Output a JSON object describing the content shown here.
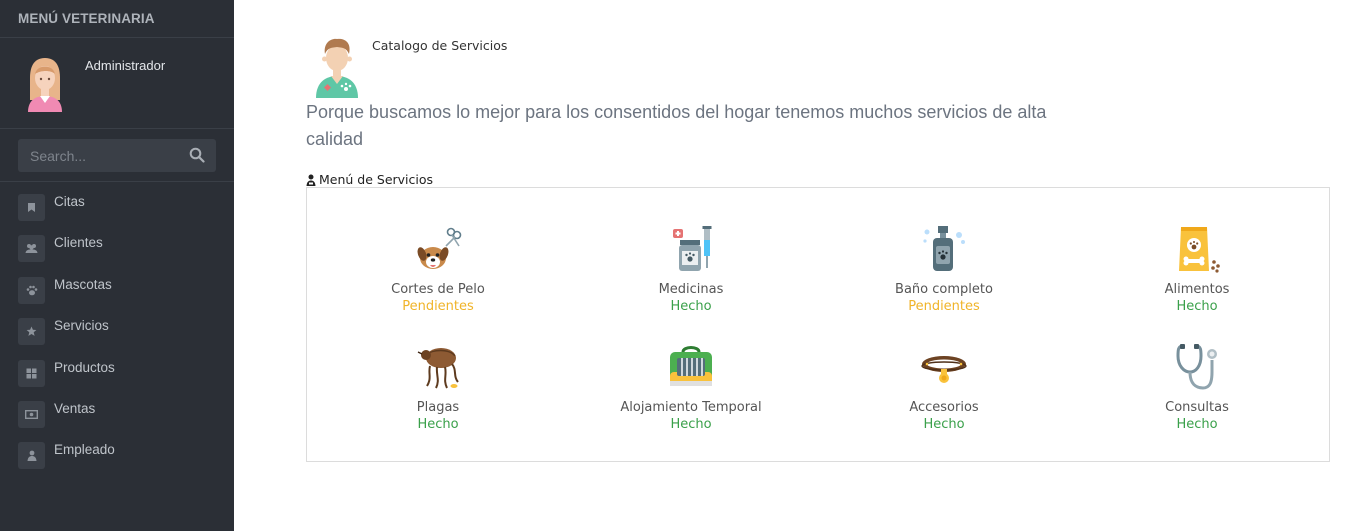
{
  "sidebar": {
    "title": "MENÚ VETERINARIA",
    "user": {
      "name": "Administrador"
    },
    "search": {
      "placeholder": "Search..."
    },
    "items": [
      {
        "label": "Citas",
        "icon": "bookmark-icon"
      },
      {
        "label": "Clientes",
        "icon": "users-icon"
      },
      {
        "label": "Mascotas",
        "icon": "paw-icon"
      },
      {
        "label": "Servicios",
        "icon": "star-icon"
      },
      {
        "label": "Productos",
        "icon": "grid-icon"
      },
      {
        "label": "Ventas",
        "icon": "money-icon"
      },
      {
        "label": "Empleado",
        "icon": "user-icon"
      }
    ]
  },
  "header": {
    "title": "Catalogo de Servicios",
    "lead": "Porque buscamos lo mejor para los consentidos del hogar tenemos muchos servicios de alta calidad"
  },
  "services": {
    "section_label": "Menú de Servicios",
    "items": [
      {
        "name": "Cortes de Pelo",
        "status": "Pendientes",
        "icon": "dog-grooming-icon"
      },
      {
        "name": "Medicinas",
        "status": "Hecho",
        "icon": "medicine-icon"
      },
      {
        "name": "Baño completo",
        "status": "Pendientes",
        "icon": "shampoo-icon"
      },
      {
        "name": "Alimentos",
        "status": "Hecho",
        "icon": "pet-food-icon"
      },
      {
        "name": "Plagas",
        "status": "Hecho",
        "icon": "flea-icon"
      },
      {
        "name": "Alojamiento Temporal",
        "status": "Hecho",
        "icon": "pet-carrier-icon"
      },
      {
        "name": "Accesorios",
        "status": "Hecho",
        "icon": "collar-icon"
      },
      {
        "name": "Consultas",
        "status": "Hecho",
        "icon": "stethoscope-icon"
      }
    ]
  },
  "colors": {
    "sidebar_bg": "#2b2f36",
    "pending": "#f0b429",
    "done": "#3aa04a"
  }
}
